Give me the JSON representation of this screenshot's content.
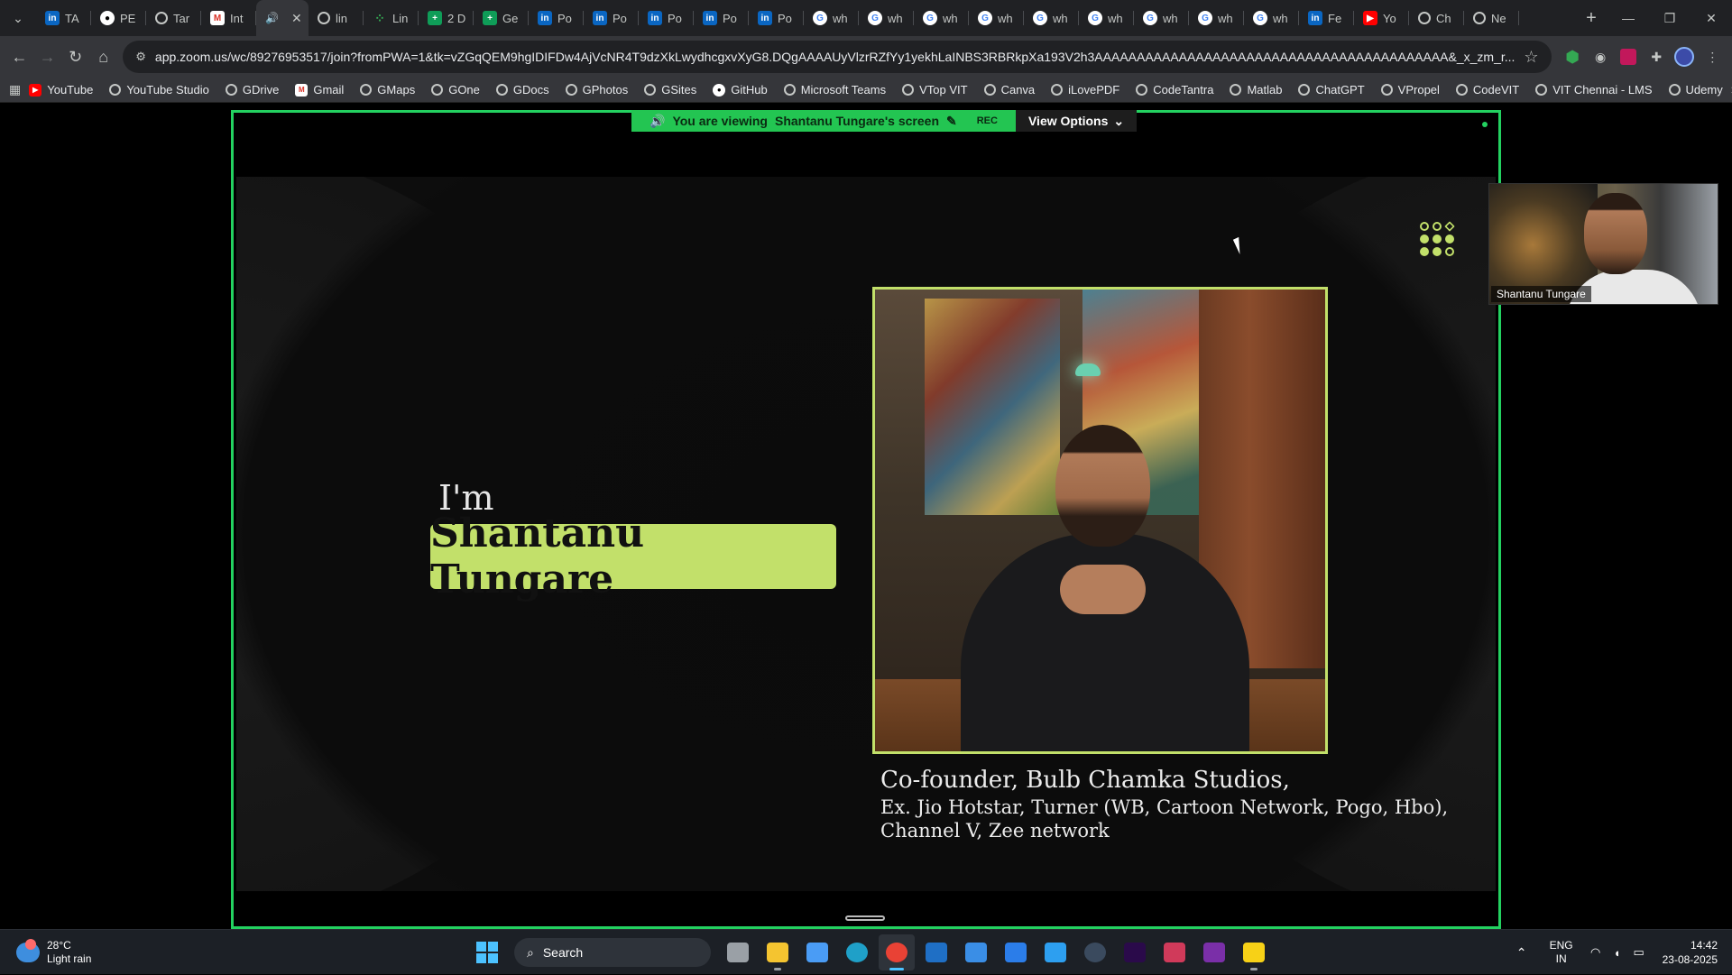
{
  "browser": {
    "tabs": [
      {
        "favicon": "linkedin",
        "label": "TA"
      },
      {
        "favicon": "github",
        "label": "PE"
      },
      {
        "favicon": "globe",
        "label": "Tar"
      },
      {
        "favicon": "gmail",
        "label": "Int"
      },
      {
        "favicon": "speaker",
        "label": "",
        "active": true
      },
      {
        "favicon": "globe",
        "label": "lin"
      },
      {
        "favicon": "linear",
        "label": "Lin"
      },
      {
        "favicon": "sheets",
        "label": "2 D"
      },
      {
        "favicon": "sheets",
        "label": "Ge"
      },
      {
        "favicon": "linkedin",
        "label": "Po"
      },
      {
        "favicon": "linkedin",
        "label": "Po"
      },
      {
        "favicon": "linkedin",
        "label": "Po"
      },
      {
        "favicon": "linkedin",
        "label": "Po"
      },
      {
        "favicon": "linkedin",
        "label": "Po"
      },
      {
        "favicon": "google",
        "label": "wh"
      },
      {
        "favicon": "google",
        "label": "wh"
      },
      {
        "favicon": "google",
        "label": "wh"
      },
      {
        "favicon": "google",
        "label": "wh"
      },
      {
        "favicon": "google",
        "label": "wh"
      },
      {
        "favicon": "google",
        "label": "wh"
      },
      {
        "favicon": "google",
        "label": "wh"
      },
      {
        "favicon": "google",
        "label": "wh"
      },
      {
        "favicon": "google",
        "label": "wh"
      },
      {
        "favicon": "linkedin",
        "label": "Fe"
      },
      {
        "favicon": "youtube",
        "label": "Yo"
      },
      {
        "favicon": "chatgpt",
        "label": "Ch"
      },
      {
        "favicon": "chatgpt",
        "label": "Ne"
      }
    ],
    "url": "app.zoom.us/wc/89276953517/join?fromPWA=1&tk=vZGqQEM9hgIDIFDw4AjVcNR4T9dzXkLwydhcgxvXyG8.DQgAAAAUyVlzrRZfYy1yekhLaINBS3RBRkpXa193V2h3AAAAAAAAAAAAAAAAAAAAAAAAAAAAAAAAAAAAAAAAAA&_x_zm_r...",
    "bookmarks": [
      {
        "favicon": "youtube",
        "label": "YouTube"
      },
      {
        "favicon": "globe",
        "label": "YouTube Studio"
      },
      {
        "favicon": "globe",
        "label": "GDrive"
      },
      {
        "favicon": "gmail",
        "label": "Gmail"
      },
      {
        "favicon": "globe",
        "label": "GMaps"
      },
      {
        "favicon": "globe",
        "label": "GOne"
      },
      {
        "favicon": "globe",
        "label": "GDocs"
      },
      {
        "favicon": "globe",
        "label": "GPhotos"
      },
      {
        "favicon": "globe",
        "label": "GSites"
      },
      {
        "favicon": "github",
        "label": "GitHub"
      },
      {
        "favicon": "globe",
        "label": "Microsoft Teams"
      },
      {
        "favicon": "globe",
        "label": "VTop VIT"
      },
      {
        "favicon": "globe",
        "label": "Canva"
      },
      {
        "favicon": "globe",
        "label": "iLovePDF"
      },
      {
        "favicon": "globe",
        "label": "CodeTantra"
      },
      {
        "favicon": "globe",
        "label": "Matlab"
      },
      {
        "favicon": "globe",
        "label": "ChatGPT"
      },
      {
        "favicon": "globe",
        "label": "VPropel"
      },
      {
        "favicon": "globe",
        "label": "CodeVIT"
      },
      {
        "favicon": "globe",
        "label": "VIT Chennai - LMS"
      },
      {
        "favicon": "globe",
        "label": "Udemy"
      }
    ]
  },
  "zoom": {
    "viewing_prefix": "You are viewing",
    "viewing_name": "Shantanu Tungare's screen",
    "rec_label": "REC",
    "view_options_label": "View Options",
    "participant_name": "Shantanu Tungare"
  },
  "slide": {
    "intro": "I'm",
    "name": "Shantanu Tungare",
    "caption_title": "Co-founder, Bulb Chamka Studios,",
    "caption_line1": "Ex. Jio Hotstar, Turner (WB, Cartoon Network, Pogo, Hbo),",
    "caption_line2": "Channel V, Zee network",
    "accent_color": "#c2e06a"
  },
  "taskbar": {
    "weather_temp": "28°C",
    "weather_desc": "Light rain",
    "search_label": "Search",
    "apps": [
      "task-view",
      "file-explorer",
      "copilot",
      "edge",
      "chrome",
      "outlook",
      "microsoft-store",
      "remote-desktop",
      "vscode",
      "steam",
      "premiere-pro",
      "snipping-tool",
      "onenote",
      "sticky-notes"
    ],
    "lang_top": "ENG",
    "lang_bottom": "IN",
    "time": "14:42",
    "date": "23-08-2025"
  }
}
